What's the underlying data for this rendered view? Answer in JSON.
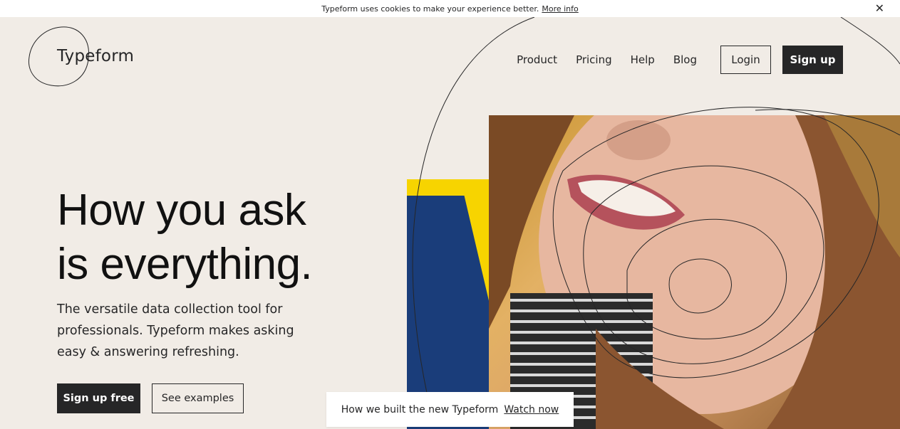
{
  "cookie_bar": {
    "text": "Typeform uses cookies to make your experience better.",
    "link": "More info",
    "close": "✕"
  },
  "header": {
    "logo": "Typeform",
    "nav": [
      "Product",
      "Pricing",
      "Help",
      "Blog"
    ],
    "login": "Login",
    "signup": "Sign up"
  },
  "hero": {
    "title_line1": "How you ask",
    "title_line2": "is everything.",
    "subtitle": "The versatile data collection tool for professionals. Typeform makes asking easy & answering refreshing.",
    "cta_primary": "Sign up free",
    "cta_secondary": "See examples"
  },
  "banner": {
    "text": "How we built the new Typeform",
    "link": "Watch now"
  },
  "colors": {
    "background": "#f1ece6",
    "dark": "#262627",
    "yellow": "#f7d400",
    "blue": "#1a3d7a"
  }
}
